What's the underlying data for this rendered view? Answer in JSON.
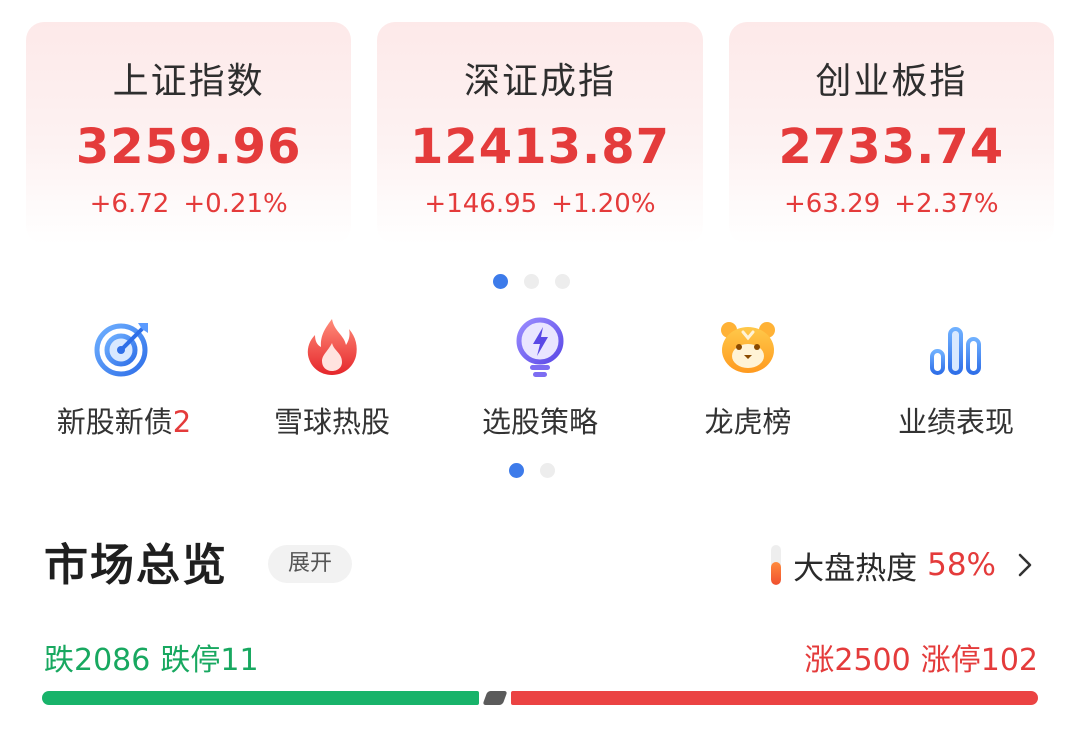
{
  "indices": [
    {
      "name": "上证指数",
      "value": "3259.96",
      "change": "+6.72",
      "change_pct": "+0.21%"
    },
    {
      "name": "深证成指",
      "value": "12413.87",
      "change": "+146.95",
      "change_pct": "+1.20%"
    },
    {
      "name": "创业板指",
      "value": "2733.74",
      "change": "+63.29",
      "change_pct": "+2.37%"
    }
  ],
  "index_pager": {
    "count": 3,
    "active": 0
  },
  "shortcuts": [
    {
      "label": "新股新债",
      "badge": "2",
      "icon": "target-icon"
    },
    {
      "label": "雪球热股",
      "badge": "",
      "icon": "flame-icon"
    },
    {
      "label": "选股策略",
      "badge": "",
      "icon": "lightbulb-icon"
    },
    {
      "label": "龙虎榜",
      "badge": "",
      "icon": "tiger-icon"
    },
    {
      "label": "业绩表现",
      "badge": "",
      "icon": "bar-chart-icon"
    }
  ],
  "shortcut_pager": {
    "count": 2,
    "active": 0
  },
  "overview": {
    "title": "市场总览",
    "expand_label": "展开",
    "heat_label": "大盘热度",
    "heat_value": "58%",
    "heat_level": 0.58,
    "down_label": "跌2086",
    "limit_down_label": "跌停11",
    "up_label": "涨2500",
    "limit_up_label": "涨停102",
    "down_count": 2086,
    "flat_count": 110,
    "up_count": 2500
  },
  "colors": {
    "up": "#e43b3b",
    "down": "#18a860",
    "accent": "#3d7bea"
  }
}
